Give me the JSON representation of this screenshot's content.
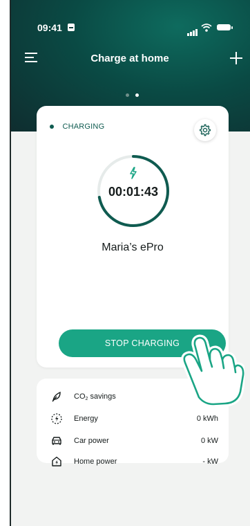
{
  "status_bar": {
    "time": "09:41"
  },
  "header": {
    "title": "Charge at home",
    "page_dots": 2,
    "active_dot": 1
  },
  "charger": {
    "status": "CHARGING",
    "elapsed": "00:01:43",
    "progress": 0.72,
    "device_name": "Maria’s ePro",
    "stop_label": "STOP CHARGING"
  },
  "stats": {
    "co2": {
      "label_main": "CO",
      "label_sub": "2",
      "label_rest": " savings",
      "value": ""
    },
    "energy": {
      "label": "Energy",
      "value": "0 kWh"
    },
    "car_power": {
      "label": "Car power",
      "value": "0 kW"
    },
    "home_power": {
      "label": "Home power",
      "value": "- kW"
    }
  },
  "colors": {
    "accent": "#1aa585",
    "dark_teal": "#0f5b50",
    "header_dark": "#0f2d2f",
    "background": "#f2f3f2"
  },
  "icons": [
    "menu-icon",
    "plus-icon",
    "gear-icon",
    "bolt-icon",
    "leaf-icon",
    "energy-icon",
    "car-icon",
    "home-power-icon",
    "tap-hand-icon"
  ]
}
